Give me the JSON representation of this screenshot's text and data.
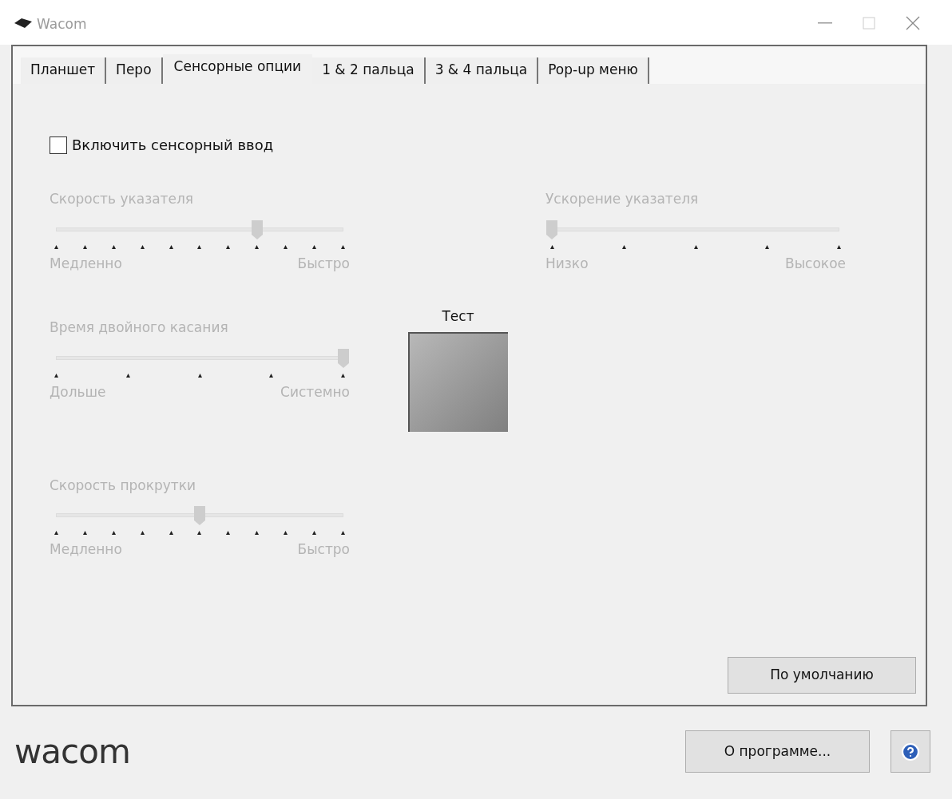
{
  "window": {
    "title": "Wacom"
  },
  "tabs": [
    {
      "label": "Планшет",
      "selected": false
    },
    {
      "label": "Перо",
      "selected": false
    },
    {
      "label": "Сенсорные опции",
      "selected": true
    },
    {
      "label": "1 & 2 пальца",
      "selected": false
    },
    {
      "label": "3 & 4 пальца",
      "selected": false
    },
    {
      "label": "Pop-up меню",
      "selected": false
    }
  ],
  "touch_input": {
    "label": "Включить сенсорный ввод",
    "checked": false
  },
  "sliders": [
    {
      "label": "Скорость указателя",
      "kind": "fine",
      "level": 0.7,
      "disabled": true,
      "min_label": "Медленно",
      "max_label": "Быстро"
    },
    {
      "label": "Ускорение указателя",
      "kind": "coarse",
      "level": 0,
      "disabled": true,
      "min_label": "Низко",
      "max_label": "Высокое"
    },
    {
      "label": "Время двойного касания",
      "kind": "coarse",
      "level": 1,
      "disabled": true,
      "min_label": "Дольше",
      "max_label": "Системно"
    },
    {
      "label": "Скорость прокрутки",
      "kind": "fine",
      "level": 0.5,
      "disabled": true,
      "min_label": "Медленно",
      "max_label": "Быстро"
    }
  ],
  "test_area": {
    "label": "Тест"
  },
  "default_button": "По умолчанию",
  "footer": {
    "logo": "wacom",
    "about_button": "О программе..."
  }
}
